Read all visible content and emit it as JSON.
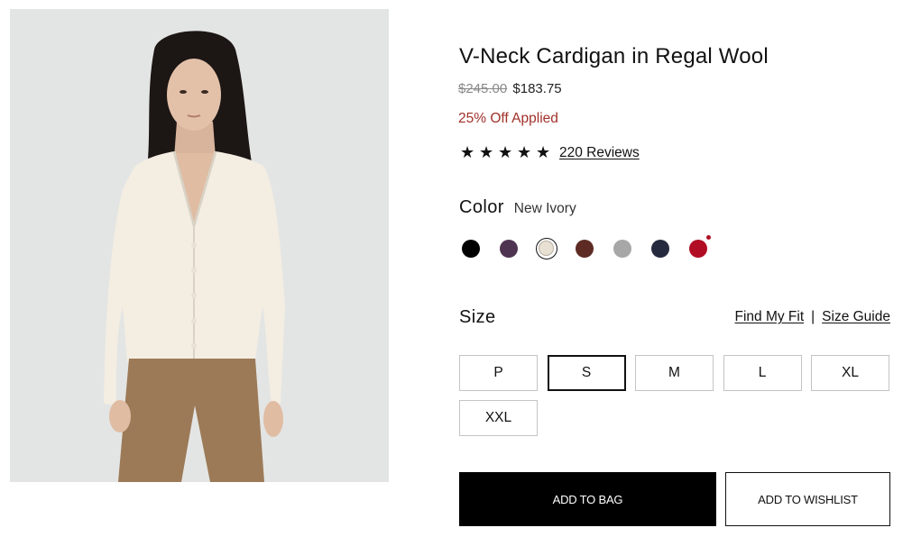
{
  "product": {
    "title": "V-Neck Cardigan in Regal Wool",
    "price_original": "$245.00",
    "price_sale": "$183.75",
    "discount_text": "25% Off Applied",
    "rating_stars": 5,
    "star_glyph": "★",
    "reviews_link": "220 Reviews",
    "image_icon": "model-photo"
  },
  "color": {
    "label": "Color",
    "selected_name": "New Ivory",
    "swatches": [
      {
        "name": "black",
        "hex": "#000000",
        "selected": false
      },
      {
        "name": "plum",
        "hex": "#4f3451",
        "selected": false
      },
      {
        "name": "new-ivory",
        "hex": "#e8e0d3",
        "selected": true
      },
      {
        "name": "brown",
        "hex": "#5d2b24",
        "selected": false
      },
      {
        "name": "grey",
        "hex": "#a7a7a7",
        "selected": false
      },
      {
        "name": "navy",
        "hex": "#262a3e",
        "selected": false
      },
      {
        "name": "red",
        "hex": "#b10d24",
        "selected": false,
        "badge_hex": "#b10d24"
      }
    ]
  },
  "size": {
    "label": "Size",
    "find_my_fit": "Find My Fit",
    "separator": "|",
    "size_guide": "Size Guide",
    "options": [
      "P",
      "S",
      "M",
      "L",
      "XL",
      "XXL"
    ],
    "selected": "S"
  },
  "actions": {
    "add_to_bag": "ADD TO BAG",
    "add_to_wishlist": "ADD TO WISHLIST"
  },
  "colors": {
    "accent_red": "#a0312a",
    "primary_button": "#000000"
  }
}
